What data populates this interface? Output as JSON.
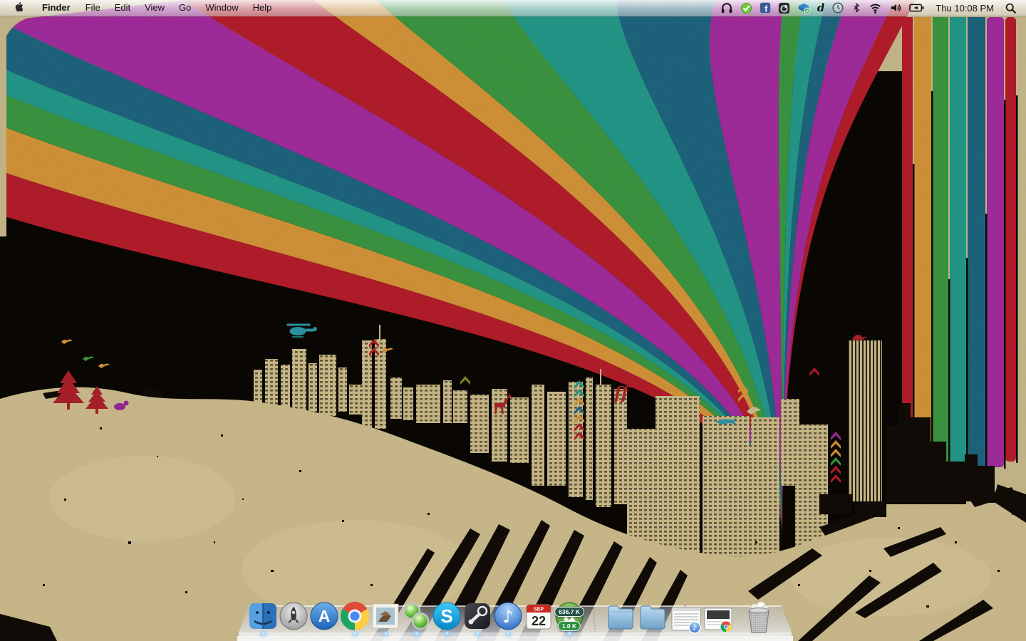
{
  "menu_bar": {
    "apple_menu": "apple-logo",
    "items": [
      {
        "label": "Finder",
        "bold": true
      },
      {
        "label": "File"
      },
      {
        "label": "Edit"
      },
      {
        "label": "View"
      },
      {
        "label": "Go"
      },
      {
        "label": "Window"
      },
      {
        "label": "Help"
      }
    ],
    "status": {
      "icons": [
        "headphones",
        "skype-online",
        "facebook",
        "phone",
        "dropbox",
        "droplr",
        "time-machine",
        "bluetooth",
        "wifi",
        "volume",
        "battery"
      ],
      "facebook_glyph": "f",
      "droplr_glyph": "d",
      "clock": "Thu 10:08 PM"
    }
  },
  "dock": {
    "items": [
      {
        "name": "finder",
        "running": true
      },
      {
        "name": "launchpad",
        "running": false
      },
      {
        "name": "app-store",
        "running": false,
        "glyph": "A"
      },
      {
        "name": "chrome",
        "running": true
      },
      {
        "name": "mail",
        "running": true
      },
      {
        "name": "messenger-green-orbs",
        "running": true
      },
      {
        "name": "skype",
        "running": true,
        "glyph": "S"
      },
      {
        "name": "steam",
        "running": true
      },
      {
        "name": "itunes",
        "running": true,
        "glyph": "♪"
      },
      {
        "name": "ical",
        "running": false,
        "month": "SEP",
        "day": "22"
      },
      {
        "name": "utorrent",
        "running": true,
        "glyph": "µ",
        "badge_top": "636.7 K",
        "badge_bottom": "1.0 K"
      },
      {
        "name": "folder-1",
        "running": false
      },
      {
        "name": "folder-2",
        "running": false
      },
      {
        "name": "minimized-itunes-window",
        "running": false
      },
      {
        "name": "minimized-chrome-window",
        "running": false
      },
      {
        "name": "trash-full",
        "running": false
      }
    ]
  },
  "wallpaper": {
    "style": "retro rainbow ribbons over grunge cityscape",
    "ff_mark": "ff",
    "colors": {
      "tan": "#d3c493",
      "sky_black": "#0b0804",
      "red": "#bf1f2e",
      "orange": "#e09d3c",
      "green": "#3f9f45",
      "teal": "#26a291",
      "blue": "#206b86",
      "magenta": "#ac2fa6",
      "ink": "#120d07",
      "building_beige": "#d9c791"
    }
  }
}
